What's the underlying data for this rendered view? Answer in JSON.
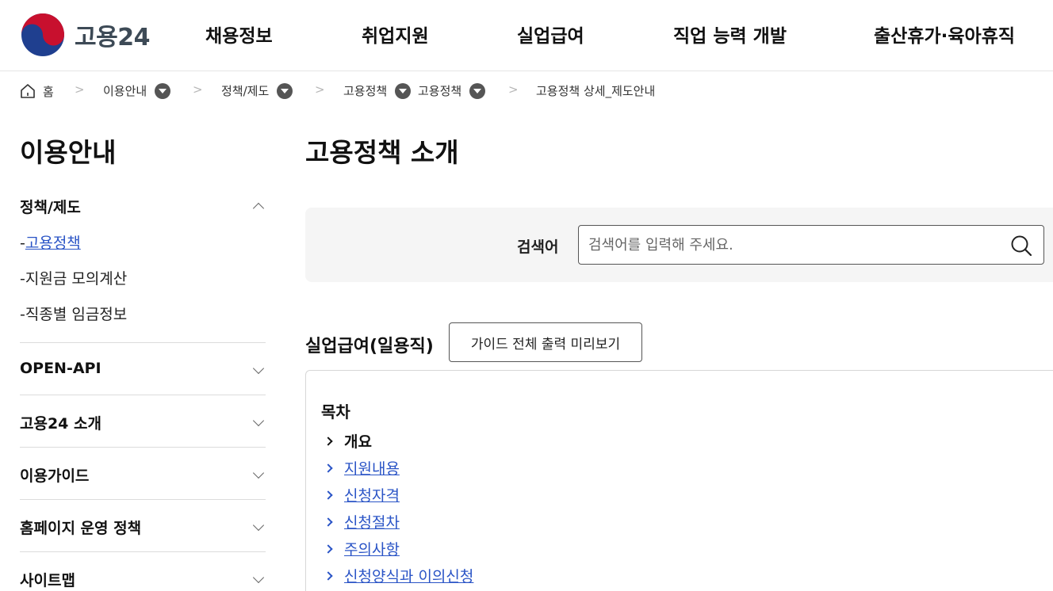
{
  "header": {
    "logo_text": "고용24",
    "nav": [
      "채용정보",
      "취업지원",
      "실업급여",
      "직업 능력 개발",
      "출산휴가·육아휴직"
    ]
  },
  "breadcrumb": {
    "home": "홈",
    "items": [
      "이용안내",
      "정책/제도",
      "고용정책",
      "고용정책",
      "고용정책 상세_제도안내"
    ]
  },
  "sidebar": {
    "title": "이용안내",
    "open_group": "정책/제도",
    "sub_items": [
      "고용정책",
      "지원금 모의계산",
      "직종별 임금정보"
    ],
    "groups": [
      "OPEN-API",
      "고용24 소개",
      "이용가이드",
      "홈페이지 운영 정책",
      "사이트맵"
    ]
  },
  "main": {
    "title": "고용정책 소개",
    "search": {
      "label": "검색어",
      "placeholder": "검색어를 입력해 주세요.",
      "value": ""
    },
    "section_title": "실업급여(일용직)",
    "guide_button": "가이드 전체 출력 미리보기",
    "toc": {
      "title": "목차",
      "items": [
        "개요",
        "지원내용",
        "신청자격",
        "신청절차",
        "주의사항",
        "신청양식과 이의신청"
      ]
    }
  },
  "colors": {
    "link": "#2a54c6",
    "logo_red": "#c8102e",
    "logo_blue": "#1f3f8f"
  },
  "icons": [
    "taegeuk-logo-icon",
    "home-icon",
    "chevron-right-icon",
    "dropdown-icon",
    "chevron-up-icon",
    "chevron-down-icon",
    "search-icon"
  ]
}
